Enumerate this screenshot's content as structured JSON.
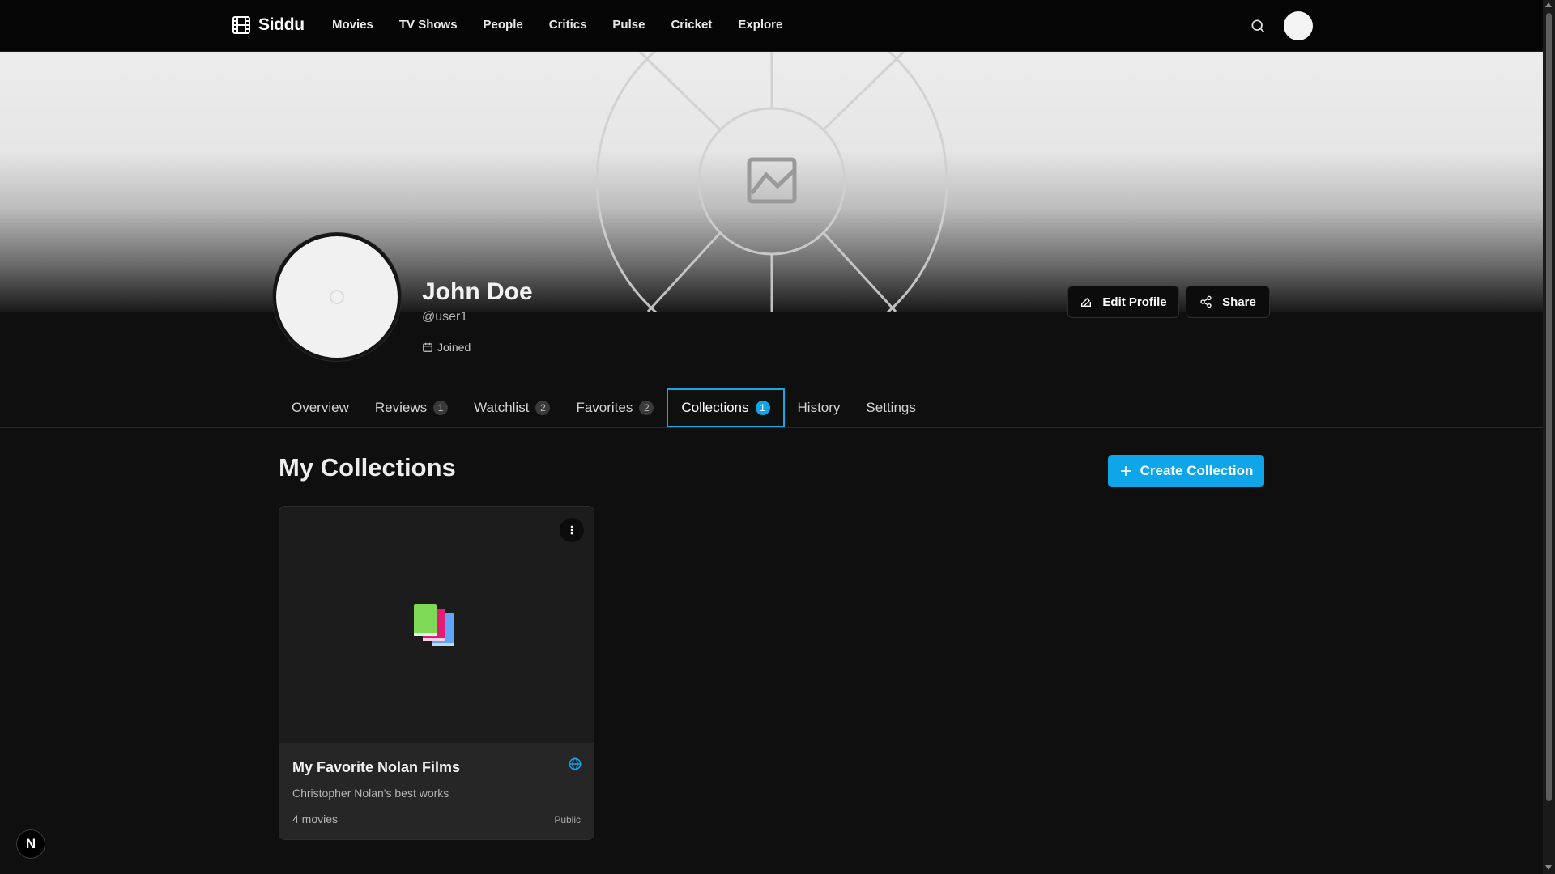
{
  "nav": {
    "brand": "Siddu",
    "links": [
      "Movies",
      "TV Shows",
      "People",
      "Critics",
      "Pulse",
      "Cricket",
      "Explore"
    ],
    "icons": {
      "logo": "film-icon",
      "search": "search-icon",
      "avatar": "user-avatar"
    }
  },
  "profile": {
    "name": "John Doe",
    "handle": "@user1",
    "joined_label": "Joined",
    "edit_label": "Edit Profile",
    "share_label": "Share"
  },
  "tabs": [
    {
      "label": "Overview",
      "count": null
    },
    {
      "label": "Reviews",
      "count": "1"
    },
    {
      "label": "Watchlist",
      "count": "2"
    },
    {
      "label": "Favorites",
      "count": "2"
    },
    {
      "label": "Collections",
      "count": "1",
      "active": true
    },
    {
      "label": "History",
      "count": null
    },
    {
      "label": "Settings",
      "count": null
    }
  ],
  "collections": {
    "title": "My Collections",
    "create_label": "Create Collection",
    "items": [
      {
        "title": "My Favorite Nolan Films",
        "description": "Christopher Nolan's best works",
        "count_label": "4 movies",
        "visibility": "Public",
        "cover_icon": "books-icon"
      }
    ]
  },
  "colors": {
    "accent": "#0ea5e9",
    "background": "#0f0f0f",
    "card": "#262626"
  },
  "dev_badge": "N"
}
